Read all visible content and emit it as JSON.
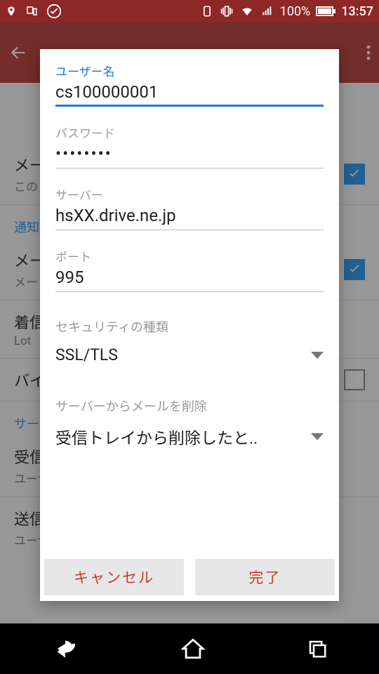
{
  "status": {
    "battery_pct": "100%",
    "time": "13:57"
  },
  "bg": {
    "section1": "通知設定",
    "section2": "サーバー設定",
    "items": [
      {
        "title": "メールアドレス",
        "sub": "この",
        "check": true
      },
      {
        "title": "メール通知",
        "sub": "メー",
        "check": true
      },
      {
        "title": "着信音",
        "sub": "Lot",
        "check": null
      },
      {
        "title": "バイブレーション",
        "sub": "",
        "check": false
      },
      {
        "title": "受信設定",
        "sub": "ユーザー名、パスワードなどの設定",
        "check": null
      },
      {
        "title": "送信設定",
        "sub": "ユーザー名、パスワードなどの設定",
        "check": null
      }
    ]
  },
  "dlg": {
    "username_label": "ユーザー名",
    "username_value": "cs100000001",
    "password_label": "パスワード",
    "password_value": "••••••••",
    "server_label": "サーバー",
    "server_value": "hsXX.drive.ne.jp",
    "port_label": "ポート",
    "port_value": "995",
    "security_label": "セキュリティの種類",
    "security_value": "SSL/TLS",
    "delete_label": "サーバーからメールを削除",
    "delete_value": "受信トレイから削除したと..",
    "cancel": "キャンセル",
    "done": "完了"
  }
}
